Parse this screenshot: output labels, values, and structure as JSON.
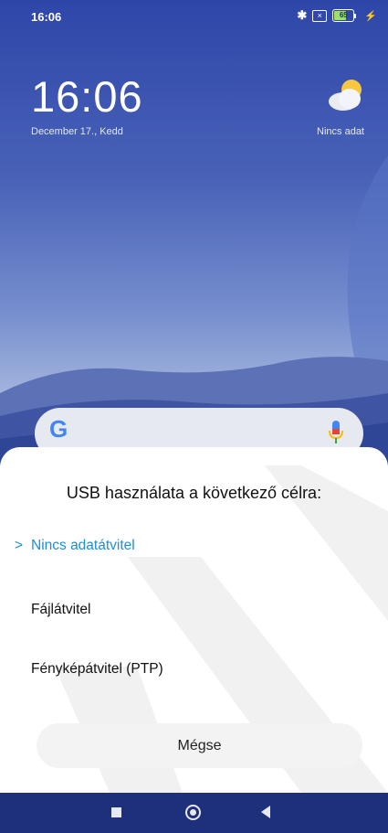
{
  "status_bar": {
    "time": "16:06",
    "battery_level": "65",
    "battery_percent": 65,
    "bluetooth_icon": "bluetooth-icon",
    "sim_icon": "no-sim-icon",
    "charging_icon": "charging-bolt-icon"
  },
  "lock_screen": {
    "clock": "16:06",
    "date": "December 17., Kedd",
    "weather_label": "Nincs adat",
    "weather_icon": "partly-cloudy-icon"
  },
  "search_bar": {
    "logo": "G",
    "mic_icon": "mic-icon"
  },
  "usb_dialog": {
    "title": "USB használata a következő célra:",
    "options": [
      {
        "label": "Nincs adatátvitel",
        "selected": true
      },
      {
        "label": "Fájlátvitel",
        "selected": false
      },
      {
        "label": "Fényképátvitel (PTP)",
        "selected": false
      }
    ],
    "selected_marker": ">",
    "cancel_label": "Mégse"
  },
  "nav_bar": {
    "recents_icon": "square-recents-icon",
    "home_icon": "circle-home-icon",
    "back_icon": "triangle-back-icon"
  },
  "colors": {
    "accent": "#1a8fd9",
    "sheet_bg": "#ffffff",
    "nav_bg": "#1e2f7c",
    "battery_fill": "#9be06a"
  }
}
